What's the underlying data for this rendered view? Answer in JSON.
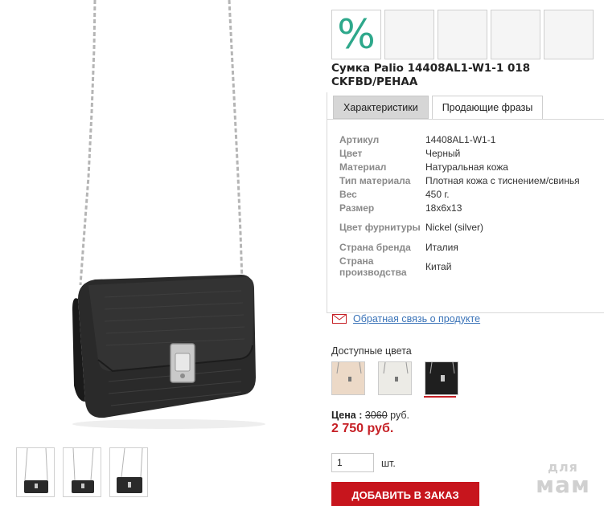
{
  "product": {
    "title": "Сумка Palio 14408AL1-W1-1 018 CKFBD/PEHAA",
    "sale_glyph": "%"
  },
  "tabs": [
    {
      "label": "Характеристики"
    },
    {
      "label": "Продающие фразы"
    }
  ],
  "specs": [
    {
      "key": "Артикул",
      "value": "14408AL1-W1-1"
    },
    {
      "key": "Цвет",
      "value": "Черный"
    },
    {
      "key": "Материал",
      "value": "Натуральная кожа"
    },
    {
      "key": "Тип материала",
      "value": "Плотная кожа с тиснением/свинья"
    },
    {
      "key": "Вес",
      "value": "450 г."
    },
    {
      "key": "Размер",
      "value": "18x6x13"
    },
    {
      "key": "Цвет фурнитуры",
      "value": "Nickel (silver)"
    },
    {
      "key": "Страна бренда",
      "value": "Италия"
    },
    {
      "key": "Страна производства",
      "value": "Китай"
    }
  ],
  "feedback": {
    "link": "Обратная связь о продукте",
    "icon": "envelope-icon"
  },
  "colors": {
    "label": "Доступные цвета",
    "options": [
      {
        "name": "beige",
        "color": "#ecd9c7"
      },
      {
        "name": "white",
        "color": "#ecebe6"
      },
      {
        "name": "black",
        "color": "#1f1f1f"
      }
    ]
  },
  "price": {
    "label": "Цена :",
    "old": "3060",
    "currency": "руб.",
    "new": "2 750 руб."
  },
  "quantity": {
    "value": "1",
    "unit": "шт."
  },
  "cart": {
    "button_label": "ДОБАВИТЬ В ЗАКАЗ"
  },
  "watermark": {
    "line1": "для",
    "line2": "мам"
  },
  "colors_theme": {
    "accent": "#c7151d",
    "link": "#3a73b8",
    "sale": "#2ea88b"
  }
}
